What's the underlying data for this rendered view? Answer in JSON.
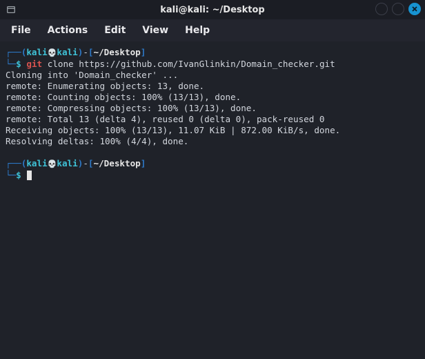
{
  "window": {
    "title": "kali@kali: ~/Desktop"
  },
  "menubar": {
    "file": "File",
    "actions": "Actions",
    "edit": "Edit",
    "view": "View",
    "help": "Help"
  },
  "prompt": {
    "branch_tl": "┌──",
    "branch_bl": "└─",
    "lparen": "(",
    "user": "kali",
    "skull": "💀",
    "host": "kali",
    "rparen": ")",
    "dash": "-",
    "lbracket": "[",
    "cwd": "~/Desktop",
    "rbracket": "]",
    "dollar": "$"
  },
  "command": {
    "prog": "git",
    "args": "clone https://github.com/IvanGlinkin/Domain_checker.git"
  },
  "output": {
    "l1": "Cloning into 'Domain_checker' ...",
    "l2": "remote: Enumerating objects: 13, done.",
    "l3": "remote: Counting objects: 100% (13/13), done.",
    "l4": "remote: Compressing objects: 100% (13/13), done.",
    "l5": "remote: Total 13 (delta 4), reused 0 (delta 0), pack-reused 0",
    "l6": "Receiving objects: 100% (13/13), 11.07 KiB | 872.00 KiB/s, done.",
    "l7": "Resolving deltas: 100% (4/4), done."
  }
}
